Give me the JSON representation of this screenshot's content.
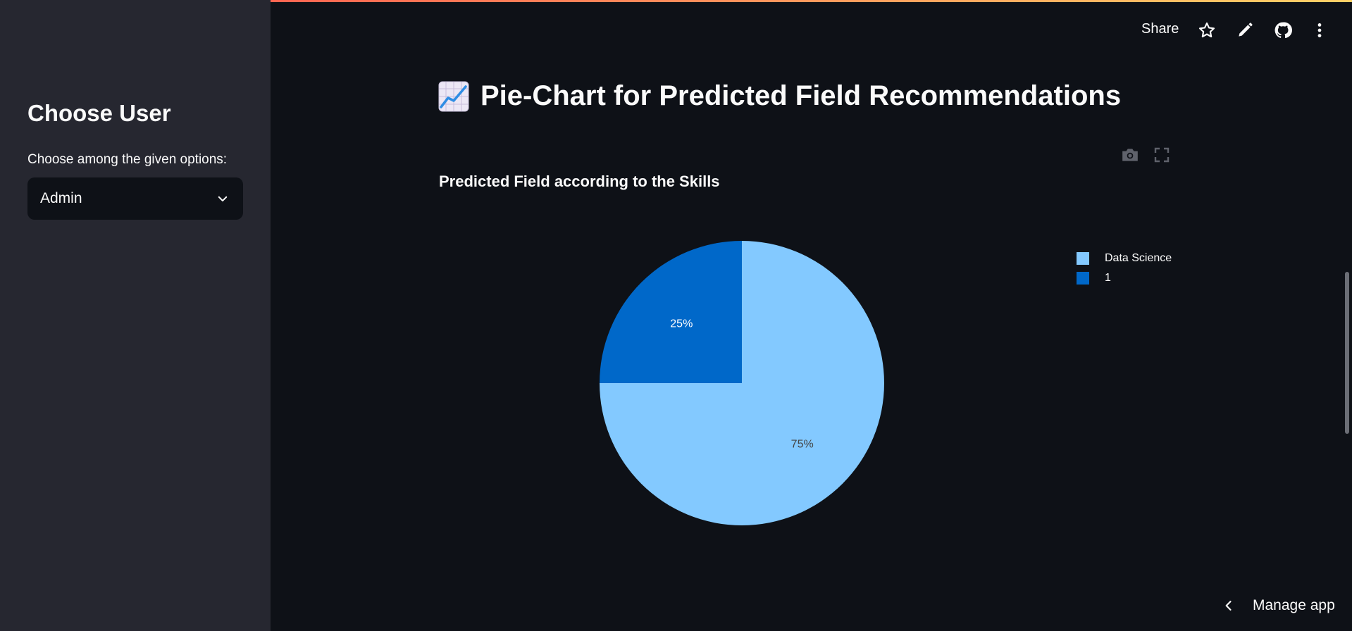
{
  "sidebar": {
    "title": "Choose User",
    "select_label": "Choose among the given options:",
    "select_value": "Admin"
  },
  "header": {
    "share_label": "Share",
    "icons": [
      "star-icon",
      "pencil-icon",
      "github-icon",
      "more-vertical-icon"
    ]
  },
  "main": {
    "title": "Pie-Chart for Predicted Field Recommendations",
    "title_emoji": "chart-increasing-emoji"
  },
  "chart_data": {
    "type": "pie",
    "title": "Predicted Field according to the Skills",
    "slices": [
      {
        "name": "Data Science",
        "value": 75,
        "label": "75%",
        "color": "#83c9ff"
      },
      {
        "name": "1",
        "value": 25,
        "label": "25%",
        "color": "#0068c9"
      }
    ],
    "legend_position": "top-right",
    "modebar_icons": [
      "camera-icon",
      "fullscreen-icon"
    ]
  },
  "footer": {
    "manage_app_label": "Manage app"
  },
  "colors": {
    "background": "#0e1117",
    "sidebar": "#262730",
    "slice_light": "#83c9ff",
    "slice_dark": "#0068c9"
  }
}
